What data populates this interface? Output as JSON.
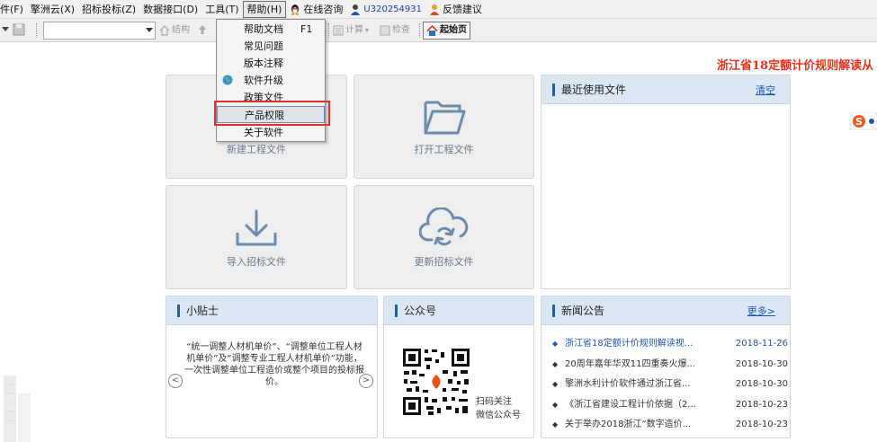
{
  "menubar": {
    "items": [
      "件(F)",
      "擎洲云(X)",
      "招标投标(Z)",
      "数据接口(D)",
      "工具(T)",
      "帮助(H)"
    ],
    "online": "在线咨询",
    "user": "U320254931",
    "feedback": "反馈建议"
  },
  "toolbar": {
    "structure": "结构",
    "calc": "计算",
    "check": "检查",
    "home": "起始页"
  },
  "banner": "浙江省18定额计价规则解读从",
  "tiles": {
    "new": "新建工程文件",
    "open": "打开工程文件",
    "import": "导入招标文件",
    "update": "更新招标文件"
  },
  "recent": {
    "title": "最近使用文件",
    "clear": "清空"
  },
  "tips": {
    "title": "小贴士",
    "text": "“统一调整人材机单价”、“调整单位工程人材机单价”及“调整专业工程人材机单价”功能，一次性调整单位工程造价或整个项目的投标报价。"
  },
  "wechat": {
    "title": "公众号",
    "line1": "扫码关注",
    "line2": "微信公众号"
  },
  "news": {
    "title": "新闻公告",
    "more": "更多>",
    "items": [
      {
        "title": "浙江省18定额计价规则解读视...",
        "date": "2018-11-26"
      },
      {
        "title": "20周年嘉年华双11四重奏火爆...",
        "date": "2018-10-30"
      },
      {
        "title": "擎洲水利计价软件通过浙江省...",
        "date": "2018-10-30"
      },
      {
        "title": "《浙江省建设工程计价依据（2...",
        "date": "2018-10-23"
      },
      {
        "title": "关于举办2018浙江“数字造价...",
        "date": "2018-10-23"
      }
    ]
  },
  "help_menu": {
    "items": [
      {
        "label": "帮助文档",
        "shortcut": "F1"
      },
      {
        "label": "常见问题",
        "shortcut": ""
      },
      {
        "label": "版本注释",
        "shortcut": ""
      },
      {
        "label": "软件升级",
        "shortcut": ""
      },
      {
        "label": "政策文件",
        "shortcut": ""
      },
      {
        "label": "产品权限",
        "shortcut": ""
      },
      {
        "label": "关于软件",
        "shortcut": ""
      }
    ]
  },
  "colors": {
    "accent": "#1e5fa8",
    "banner": "#e8321c",
    "highlight_box": "#e03030",
    "panel_header": "#dbe7f2"
  }
}
